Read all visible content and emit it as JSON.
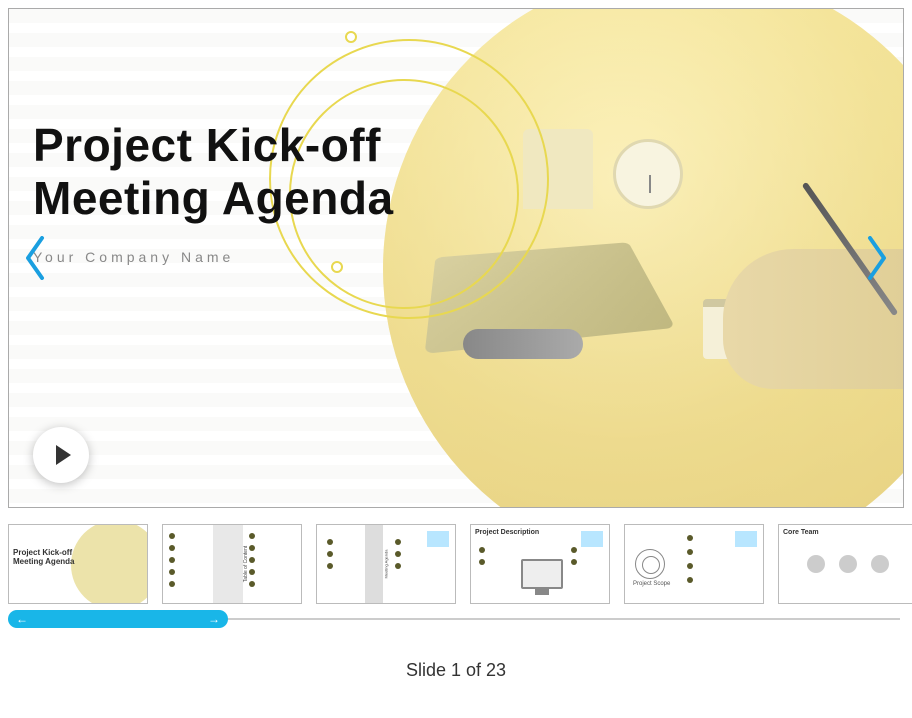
{
  "slide": {
    "title_line1": "Project Kick-off",
    "title_line2": "Meeting Agenda",
    "subtitle": "Your Company Name"
  },
  "thumbnails": [
    {
      "title": "Project Kick-off\nMeeting Agenda"
    },
    {
      "title": "Table of Content"
    },
    {
      "title": "Meeting Agenda"
    },
    {
      "title": "Project Description"
    },
    {
      "title": "Project Scope"
    },
    {
      "title": "Core Team"
    }
  ],
  "counter": {
    "prefix": "Slide ",
    "current": 1,
    "of_word": " of ",
    "total": 23
  },
  "colors": {
    "accent": "#19b6e8",
    "ring": "#e8d850"
  }
}
